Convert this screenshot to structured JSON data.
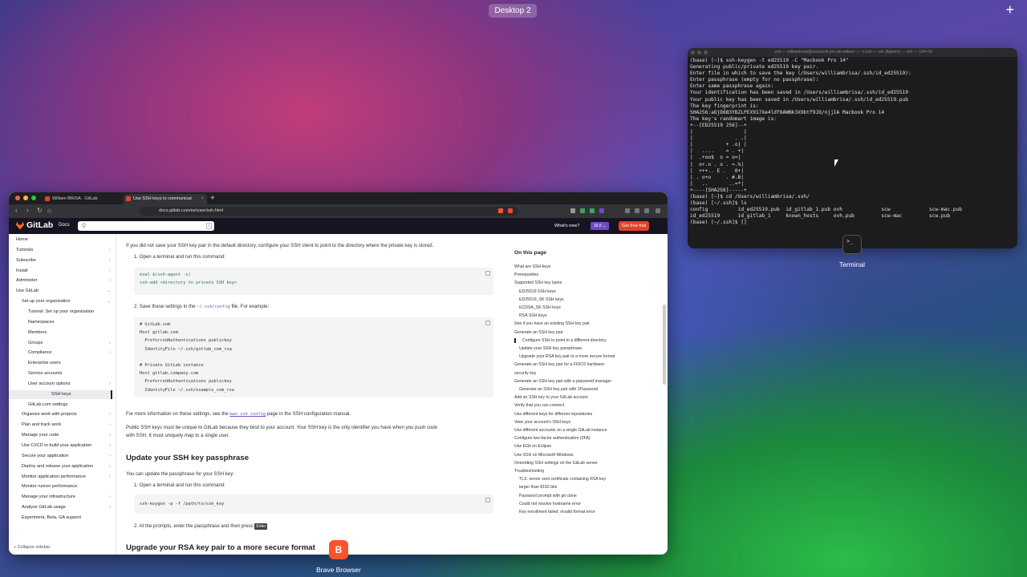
{
  "desktop": {
    "label": "Desktop 2",
    "add": "+"
  },
  "terminal": {
    "title": "..ssh — williambrisa@macbook-pro-de-william — ~/.ssh — zsh (figterm) — zsh — 104×29",
    "lines": [
      "(base) [~]$ ssh-keygen -t ed25519 -C \"Macbook Pro 14\"",
      "Generating public/private ed25519 key pair.",
      "Enter file in which to save the key (/Users/williambrisa/.ssh/id_ed25519):",
      "Enter passphrase (empty for no passphrase):",
      "Enter same passphrase again:",
      "Your identification has been saved in /Users/williambrisa/.ssh/id_ed25519",
      "Your public key has been saved in /Users/williambrisa/.ssh/id_ed25519.pub",
      "The key fingerprint is:",
      "SHA256:aOjD6B3YBZLPEX917Xe4ldf6AWNk3X9btf9JO/njjIA Macbook Pro 14",
      "The key's randomart image is:",
      "+--[ED25519 256]--+",
      "|                 |",
      "|              . .|",
      "|           + .o| |",
      "|   ....    = . +|",
      "|  .+oo$  o = o=|",
      "|  o+.o . o . =.%|",
      "|  +++.. E .   0+|",
      "| . o+o     . #.B|",
      "|   ..       ..=*|",
      "+----[SHA256]-----+",
      "(base) [~]$ cd /Users/williambrisa/.ssh/",
      "(base) [~/.ssh]$ ls",
      "config          id_ed25519.pub  id_gitlab_1.pub ovh             scw             scw-mac.pub",
      "id_ed25519      id_gitlab_1     known_hosts     ovh.pub         scw-mac         scw.pub",
      "(base) [~/.ssh]$ []"
    ],
    "dock_label": "Terminal",
    "icon_glyph": ">_"
  },
  "browser": {
    "tabs": [
      {
        "label": "William BRISA · GitLab"
      },
      {
        "label": "Use SSH keys to communicat"
      }
    ],
    "newtab": "+",
    "url": "docs.gitlab.com/ee/user/ssh.html",
    "header": {
      "brand": "GitLab",
      "docs": "Docs",
      "search_hint": "Q",
      "slash": "/",
      "whats_new": "What's new?",
      "version": "16.5 ⌄",
      "trial": "Get free trial"
    },
    "sidebar": [
      {
        "label": "Home",
        "indent": 0,
        "chev": ""
      },
      {
        "label": "Tutorials",
        "indent": 0,
        "chev": "›"
      },
      {
        "label": "Subscribe",
        "indent": 0,
        "chev": "›"
      },
      {
        "label": "Install",
        "indent": 0,
        "chev": "›"
      },
      {
        "label": "Administer",
        "indent": 0,
        "chev": "›"
      },
      {
        "label": "Use GitLab",
        "indent": 0,
        "chev": "⌄"
      },
      {
        "label": "Set up your organization",
        "indent": 1,
        "chev": "⌄"
      },
      {
        "label": "Tutorial: Set up your organization",
        "indent": 2,
        "chev": ""
      },
      {
        "label": "Namespaces",
        "indent": 2,
        "chev": ""
      },
      {
        "label": "Members",
        "indent": 2,
        "chev": ""
      },
      {
        "label": "Groups",
        "indent": 2,
        "chev": "›"
      },
      {
        "label": "Compliance",
        "indent": 2,
        "chev": "›"
      },
      {
        "label": "Enterprise users",
        "indent": 2,
        "chev": ""
      },
      {
        "label": "Service accounts",
        "indent": 2,
        "chev": ""
      },
      {
        "label": "User account options",
        "indent": 2,
        "chev": "›"
      },
      {
        "label": "SSH keys",
        "indent": 2,
        "chev": "",
        "selected": true
      },
      {
        "label": "GitLab.com settings",
        "indent": 2,
        "chev": ""
      },
      {
        "label": "Organize work with projects",
        "indent": 1,
        "chev": "›"
      },
      {
        "label": "Plan and track work",
        "indent": 1,
        "chev": "›"
      },
      {
        "label": "Manage your code",
        "indent": 1,
        "chev": "›"
      },
      {
        "label": "Use CI/CD to build your application",
        "indent": 1,
        "chev": "›"
      },
      {
        "label": "Secure your application",
        "indent": 1,
        "chev": "›"
      },
      {
        "label": "Deploy and release your application",
        "indent": 1,
        "chev": "›"
      },
      {
        "label": "Monitor application performance",
        "indent": 1,
        "chev": "›"
      },
      {
        "label": "Monitor runner performance",
        "indent": 1,
        "chev": ""
      },
      {
        "label": "Manage your infrastructure",
        "indent": 1,
        "chev": "›"
      },
      {
        "label": "Analyze GitLab usage",
        "indent": 1,
        "chev": "›"
      },
      {
        "label": "Experiment, Beta, GA support",
        "indent": 1,
        "chev": ""
      }
    ],
    "collapse": "« Collapse sidebar",
    "content": {
      "intro": "If you did not save your SSH key pair in the default directory, configure your SSH client to point to the directory where the private key is stored.",
      "step1": "1. Open a terminal and run this command:",
      "code1": "eval $(ssh-agent -s)\nssh-add <directory to private SSH key>",
      "step2a": "2. Save these settings in the",
      "step2code": "~/.ssh/config",
      "step2b": "file. For example:",
      "code2": "# GitLab.com\nHost gitlab.com\n  PreferredAuthentications publickey\n  IdentityFile ~/.ssh/gitlab_com_rsa\n\n# Private GitLab instance\nHost gitlab.company.com\n  PreferredAuthentications publickey\n  IdentityFile ~/.ssh/example_com_rsa",
      "more_a": "For more information on these settings, see the",
      "more_code": "man ssh_config",
      "more_b": "page in the SSH configuration manual.",
      "public1": "Public SSH keys must be unique to GitLab because they bind to your account. Your SSH key is the only identifier you have when you push code",
      "public2": "with SSH. It must uniquely map to a single user.",
      "h_update": "Update your SSH key passphrase",
      "update_intro": "You can update the passphrase for your SSH key:",
      "step1b": "1. Open a terminal and run this command:",
      "code3": "ssh-keygen -p -f /path/to/ssh_key",
      "step2c": "2. At the prompts, enter the passphrase and then press",
      "enter": "Enter",
      "h_upgrade": "Upgrade your RSA key pair to a more secure format"
    },
    "toc_title": "On this page",
    "toc": [
      {
        "label": "What are SSH keys",
        "level": 0
      },
      {
        "label": "Prerequisites",
        "level": 0
      },
      {
        "label": "Supported SSH key types",
        "level": 0
      },
      {
        "label": "ED25519 SSH keys",
        "level": 1
      },
      {
        "label": "ED25519_SK SSH keys",
        "level": 1
      },
      {
        "label": "ECDSA_SK SSH keys",
        "level": 1
      },
      {
        "label": "RSA SSH keys",
        "level": 1
      },
      {
        "label": "See if you have an existing SSH key pair",
        "level": 0
      },
      {
        "label": "Generate an SSH key pair",
        "level": 0
      },
      {
        "label": "Configure SSH to point to a different directory",
        "level": 1,
        "active": true
      },
      {
        "label": "Update your SSH key passphrase",
        "level": 1
      },
      {
        "label": "Upgrade your RSA key pair to a more secure format",
        "level": 1
      },
      {
        "label": "Generate an SSH key pair for a FIDO2 hardware",
        "level": 0
      },
      {
        "label": "security key",
        "level": 0
      },
      {
        "label": "Generate an SSH key pair with a password manager",
        "level": 0
      },
      {
        "label": "Generate an SSH key pair with 1Password",
        "level": 1
      },
      {
        "label": "Add an SSH key to your GitLab account",
        "level": 0
      },
      {
        "label": "Verify that you can connect",
        "level": 0
      },
      {
        "label": "Use different keys for different repositories",
        "level": 0
      },
      {
        "label": "View your account's SSH keys",
        "level": 0
      },
      {
        "label": "Use different accounts on a single GitLab instance",
        "level": 0
      },
      {
        "label": "Configure two-factor authentication (2FA)",
        "level": 0
      },
      {
        "label": "Use EGit on Eclipse",
        "level": 0
      },
      {
        "label": "Use SSH on Microsoft Windows",
        "level": 0
      },
      {
        "label": "Overriding SSH settings on the GitLab server",
        "level": 0
      },
      {
        "label": "Troubleshooting",
        "level": 0
      },
      {
        "label": "TLS: server sent certificate containing RSA key",
        "level": 1
      },
      {
        "label": "larger than 8192 bits",
        "level": 1
      },
      {
        "label": "Password prompt with git clone",
        "level": 1
      },
      {
        "label": "Could not resolve hostname error",
        "level": 1
      },
      {
        "label": "Key enrollment failed: invalid format error",
        "level": 1
      }
    ]
  },
  "dock": {
    "brave_label": "Brave Browser",
    "brave_glyph": "B"
  },
  "colors": {
    "gitlab_header": "#171321",
    "accent": "#6e49cb",
    "trial": "#e24329"
  }
}
